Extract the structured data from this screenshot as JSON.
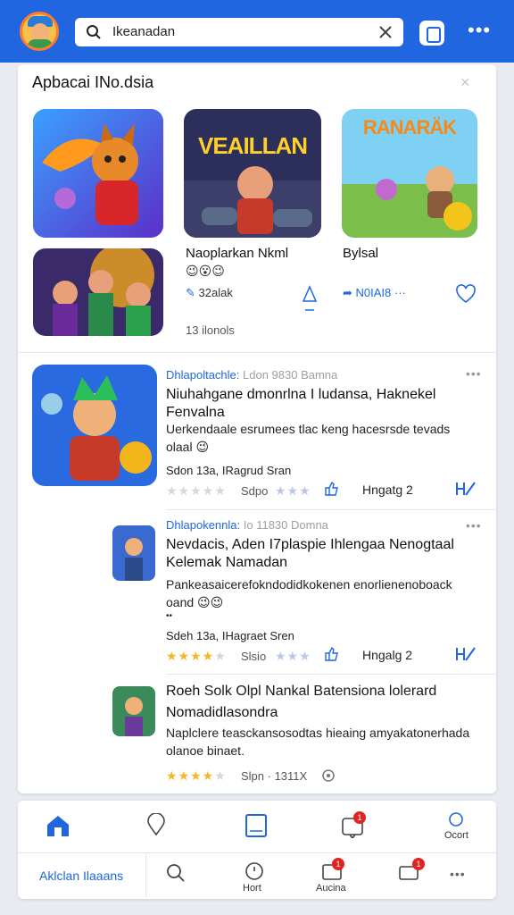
{
  "header": {
    "search_value": "Ikeanadan"
  },
  "card": {
    "title": "Apbacai INo.dsia",
    "close": "×",
    "apps": [
      {
        "name": "Naoplarkan Nkml",
        "emoji": "😉😮😉",
        "likes": "32alak"
      },
      {
        "name": "Bylsal",
        "share": "N0IAI8 ···"
      }
    ],
    "thumb_titles": [
      "VEAILLAN",
      "RANARÄK"
    ],
    "more_count": "13 ilonols"
  },
  "posts": [
    {
      "author": "Dhlapoltachle:",
      "meta": "Ldon 9830 Bamna",
      "title": "Niuhahgane dmonrlna I ludansa, Haknekel Fenvalna",
      "body": "Uerkendaale esrumees tlac keng hacesrsde tevads olaal 😉",
      "stats": "Sdon 13a, IRagrud Sran",
      "stars_label": "Sdpo",
      "reply": "Hngatg 2",
      "rating": 0
    },
    {
      "author": "Dhlapokennla:",
      "meta": "Io 11830 Domna",
      "title": "Nevdacis, Aden I7plaspie Ihlengaa Nenogtaal Kelemak Namadan",
      "body": "Pankeasaicerefokndodidkokenen enorlienenoboack oand 😉😉",
      "extra": "••",
      "stats": "Sdeh 13a, IHagraet Sren",
      "stars_label": "Slsio",
      "reply": "Hngalg 2",
      "rating": 4
    },
    {
      "author": "Roeh",
      "meta": "Solk Olpl Nankal Batensiona lolerard",
      "title": "Nomadidlasondra",
      "body": "Naplclere teasckansosodtas hieaing amyakatonerhada olanoe binaet.",
      "stats": "Slpn · 1311X",
      "rating": 4
    }
  ],
  "bottom_nav": {
    "row1": {
      "gear_label": "Ocort",
      "badge": "1"
    },
    "row2": {
      "label": "Aklclan Ilaaans",
      "hort": "Hort",
      "aucina": "Aucina",
      "badge_a": "1",
      "badge_b": "1"
    }
  },
  "colors": {
    "brand_blue": "#1f66e0",
    "badge_red": "#e02424",
    "star_gold": "#f5b623"
  }
}
